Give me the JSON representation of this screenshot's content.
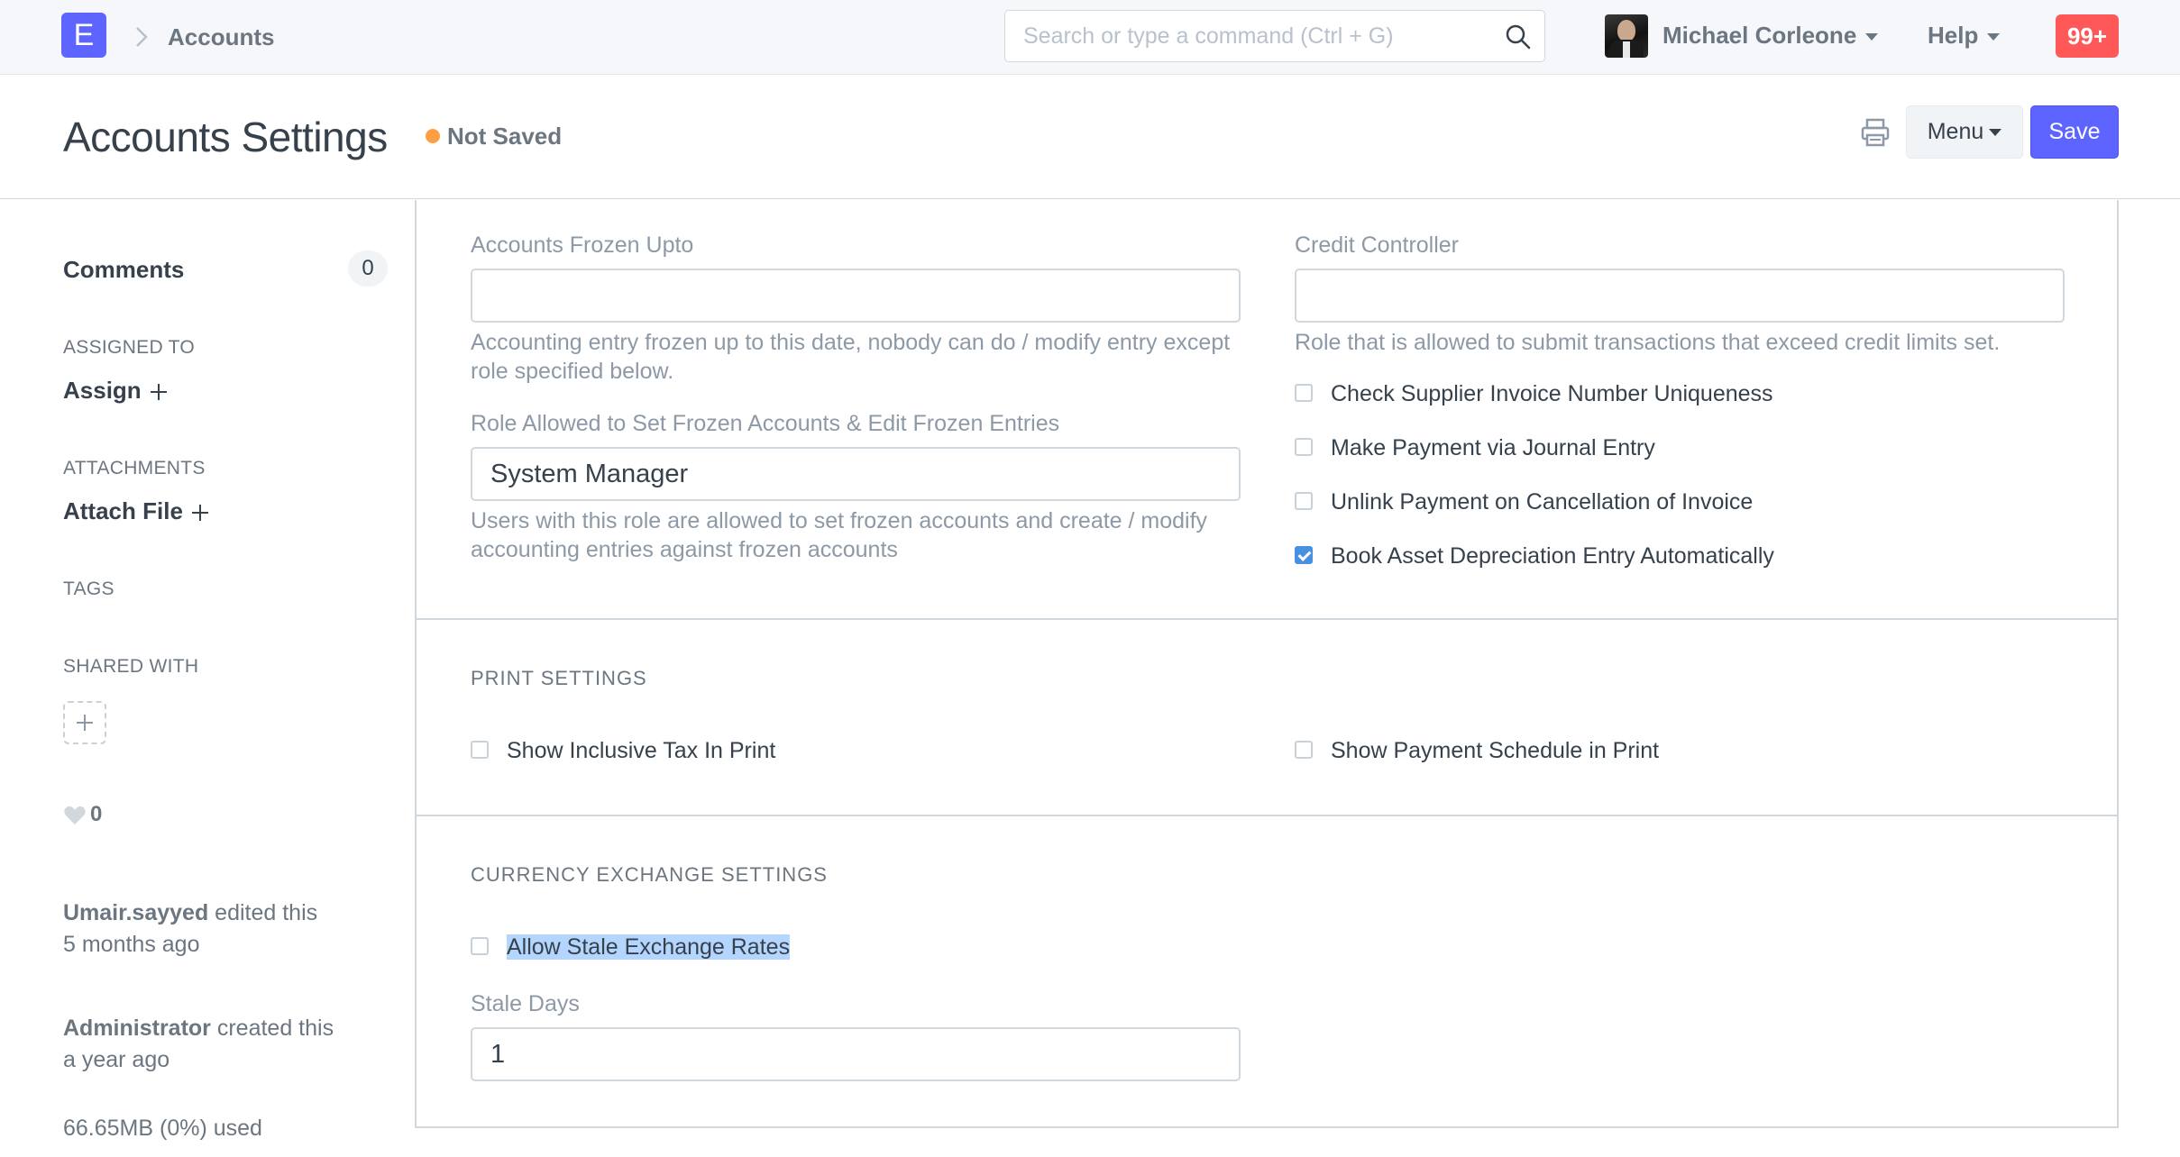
{
  "app": {
    "logo_letter": "E",
    "breadcrumb": "Accounts",
    "search_placeholder": "Search or type a command (Ctrl + G)",
    "user_name": "Michael Corleone",
    "help_label": "Help",
    "notification_count": "99+"
  },
  "page": {
    "title": "Accounts Settings",
    "status": "Not Saved",
    "menu_label": "Menu",
    "save_label": "Save"
  },
  "sidebar": {
    "comments_label": "Comments",
    "comments_count": "0",
    "assigned_to_label": "ASSIGNED TO",
    "assign_label": "Assign",
    "attachments_label": "ATTACHMENTS",
    "attach_label": "Attach File",
    "tags_label": "TAGS",
    "shared_with_label": "SHARED WITH",
    "likes_count": "0",
    "activity": [
      {
        "user": "Umair.sayyed",
        "action": " edited this",
        "time": "5 months ago"
      },
      {
        "user": "Administrator",
        "action": " created this",
        "time": "a year ago"
      }
    ],
    "storage_usage": "66.65MB (0%) used"
  },
  "form": {
    "frozen_upto_label": "Accounts Frozen Upto",
    "frozen_upto_value": "",
    "frozen_upto_help": "Accounting entry frozen up to this date, nobody can do / modify entry except role specified below.",
    "frozen_role_label": "Role Allowed to Set Frozen Accounts & Edit Frozen Entries",
    "frozen_role_value": "System Manager",
    "frozen_role_help": "Users with this role are allowed to set frozen accounts and create / modify accounting entries against frozen accounts",
    "credit_controller_label": "Credit Controller",
    "credit_controller_value": "",
    "credit_controller_help": "Role that is allowed to submit transactions that exceed credit limits set.",
    "checkboxes": [
      {
        "label": "Check Supplier Invoice Number Uniqueness",
        "checked": false
      },
      {
        "label": "Make Payment via Journal Entry",
        "checked": false
      },
      {
        "label": "Unlink Payment on Cancellation of Invoice",
        "checked": false
      },
      {
        "label": "Book Asset Depreciation Entry Automatically",
        "checked": true
      }
    ],
    "print_settings_title": "PRINT SETTINGS",
    "show_inclusive_tax_label": "Show Inclusive Tax In Print",
    "show_payment_schedule_label": "Show Payment Schedule in Print",
    "currency_title": "CURRENCY EXCHANGE SETTINGS",
    "allow_stale_label": "Allow Stale Exchange Rates",
    "stale_days_label": "Stale Days",
    "stale_days_value": "1"
  }
}
